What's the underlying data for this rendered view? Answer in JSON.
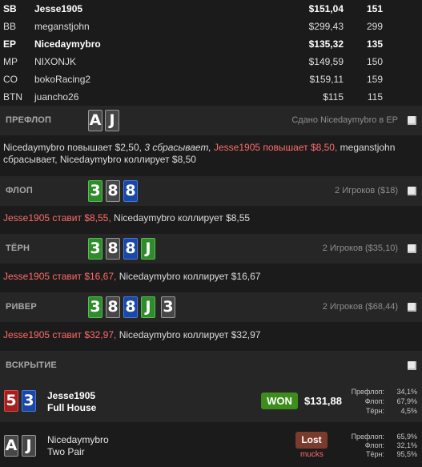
{
  "players": [
    {
      "pos": "SB",
      "name": "Jesse1905",
      "stack": "$151,04",
      "bb": "151",
      "bold": true
    },
    {
      "pos": "BB",
      "name": "meganstjohn",
      "stack": "$299,43",
      "bb": "299",
      "bold": false
    },
    {
      "pos": "EP",
      "name": "Nicedaymybro",
      "stack": "$135,32",
      "bb": "135",
      "bold": true
    },
    {
      "pos": "MP",
      "name": "NIXONJK",
      "stack": "$149,59",
      "bb": "150",
      "bold": false
    },
    {
      "pos": "CO",
      "name": "bokoRacing2",
      "stack": "$159,11",
      "bb": "159",
      "bold": false
    },
    {
      "pos": "BTN",
      "name": "juancho26",
      "stack": "$115",
      "bb": "115",
      "bold": false
    }
  ],
  "preflop": {
    "label": "ПРЕФЛОП",
    "cards": [
      "A",
      "J"
    ],
    "info": "Сдано Nicedaymybro в EP",
    "actions": {
      "p1": "Nicedaymybro повышает $2,50,",
      "p2": "3 сбрасывает,",
      "p3": "Jesse1905 повышает $8,50,",
      "p4": "meganstjohn",
      "line2": "сбрасывает, Nicedaymybro коллирует $8,50"
    }
  },
  "flop": {
    "label": "ФЛОП",
    "cards": [
      "3",
      "8",
      "8"
    ],
    "info": "2 Игроков ($18)",
    "action_red": "Jesse1905 ставит $8,55,",
    "action_rest": "Nicedaymybro коллирует $8,55"
  },
  "turn": {
    "label": "ТЁРН",
    "cards": [
      "3",
      "8",
      "8",
      "J"
    ],
    "info": "2 Игроков ($35,10)",
    "action_red": "Jesse1905 ставит $16,67,",
    "action_rest": "Nicedaymybro коллирует $16,67"
  },
  "river": {
    "label": "РИВЕР",
    "cards": [
      "3",
      "8",
      "8",
      "J",
      "3"
    ],
    "info": "2 Игроков ($68,44)",
    "action_red": "Jesse1905 ставит $32,97,",
    "action_rest": "Nicedaymybro коллирует $32,97"
  },
  "showdown": {
    "label": "ВСКРЫТИЕ",
    "winner": {
      "cards": [
        "5",
        "3"
      ],
      "name": "Jesse1905",
      "hand": "Full House",
      "badge": "WON",
      "amount": "$131,88",
      "equity": [
        {
          "label": "Префлоп:",
          "value": "34,1%"
        },
        {
          "label": "Флоп:",
          "value": "67,9%"
        },
        {
          "label": "Тёрн:",
          "value": "4,5%"
        }
      ]
    },
    "loser": {
      "cards": [
        "A",
        "J"
      ],
      "name": "Nicedaymybro",
      "hand": "Two Pair",
      "badge": "Lost",
      "status": "mucks",
      "equity": [
        {
          "label": "Префлоп:",
          "value": "65,9%"
        },
        {
          "label": "Флоп:",
          "value": "32,1%"
        },
        {
          "label": "Тёрн:",
          "value": "95,5%"
        }
      ]
    }
  },
  "colors": {
    "card_green": "#2f8c2c",
    "card_blue": "#1a48a8",
    "card_grey": "#474747",
    "card_red": "#a81d1d",
    "won": "#3d8c1c",
    "lost": "#7a3a2c",
    "highlight_red": "#ff6b6b"
  }
}
